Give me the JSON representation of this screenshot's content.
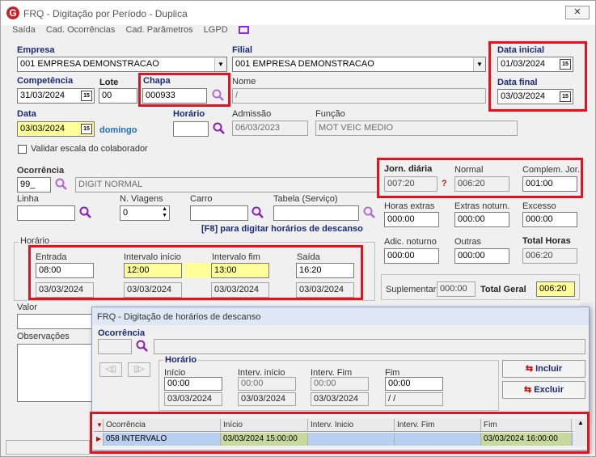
{
  "window": {
    "title": "FRQ - Digitação por Período - Duplica",
    "close": "✕"
  },
  "menu": [
    "Saída",
    "Cad. Ocorrências",
    "Cad. Parâmetros",
    "LGPD"
  ],
  "empresa": {
    "label": "Empresa",
    "value": "001 EMPRESA DEMONSTRACAO"
  },
  "filial": {
    "label": "Filial",
    "value": "001 EMPRESA DEMONSTRACAO"
  },
  "data_inicial": {
    "label": "Data inicial",
    "value": "01/03/2024"
  },
  "data_final": {
    "label": "Data final",
    "value": "03/03/2024"
  },
  "competencia": {
    "label": "Competência",
    "value": "31/03/2024"
  },
  "lote": {
    "label": "Lote",
    "value": "00"
  },
  "chapa": {
    "label": "Chapa",
    "value": "000933"
  },
  "nome": {
    "label": "Nome",
    "value": "/"
  },
  "data": {
    "label": "Data",
    "value": "03/03/2024",
    "weekday": "domingo"
  },
  "horario": {
    "label": "Horário",
    "value": ""
  },
  "admissao": {
    "label": "Admissão",
    "value": "06/03/2023"
  },
  "funcao": {
    "label": "Função",
    "value": "MOT VEIC MEDIO"
  },
  "validar": {
    "label": "Validar escala do colaborador"
  },
  "ocorrencia": {
    "label": "Ocorrência",
    "code": "99_",
    "desc": "DIGIT NORMAL"
  },
  "linha": {
    "label": "Linha",
    "value": ""
  },
  "n_viagens": {
    "label": "N. Viagens",
    "value": "0"
  },
  "carro": {
    "label": "Carro",
    "value": ""
  },
  "tabela": {
    "label": "Tabela (Serviço)",
    "value": ""
  },
  "f8_hint": "[F8] para digitar horários de descanso",
  "jorn": {
    "label": "Jorn. diária",
    "value": "007:20",
    "flag": "?"
  },
  "normal": {
    "label": "Normal",
    "value": "006:20"
  },
  "complem": {
    "label": "Complem. Jor.",
    "value": "001:00"
  },
  "horas_extras": {
    "label": "Horas extras",
    "value": "000:00"
  },
  "extras_noturn": {
    "label": "Extras noturn.",
    "value": "000:00"
  },
  "excesso": {
    "label": "Excesso",
    "value": "000:00"
  },
  "adic_noturno": {
    "label": "Adic. noturno",
    "value": "000:00"
  },
  "outras": {
    "label": "Outras",
    "value": "000:00"
  },
  "total_horas": {
    "label": "Total Horas",
    "value": "006:20"
  },
  "suplementar": {
    "label": "Suplementar",
    "value": "000:00"
  },
  "total_geral": {
    "label": "Total Geral",
    "value": "006:20"
  },
  "horario_group": {
    "label": "Horário",
    "entrada": {
      "label": "Entrada",
      "time": "08:00",
      "date": "03/03/2024"
    },
    "int_ini": {
      "label": "Intervalo início",
      "time": "12:00",
      "date": "03/03/2024"
    },
    "int_fim": {
      "label": "Intervalo fim",
      "time": "13:00",
      "date": "03/03/2024"
    },
    "saida": {
      "label": "Saída",
      "time": "16:20",
      "date": "03/03/2024"
    }
  },
  "valor": {
    "label": "Valor"
  },
  "observacoes": {
    "label": "Observações"
  },
  "dialog": {
    "title": "FRQ - Digitação de horários de descanso",
    "ocorrencia": {
      "label": "Ocorrência"
    },
    "horario": {
      "label": "Horário",
      "inicio": {
        "label": "Início",
        "time": "00:00",
        "date": "03/03/2024"
      },
      "int_ini": {
        "label": "Interv. início",
        "time": "00:00",
        "date": "03/03/2024"
      },
      "int_fim": {
        "label": "Interv. Fim",
        "time": "00:00",
        "date": "03/03/2024"
      },
      "fim": {
        "label": "Fim",
        "time": "00:00",
        "date": "/ /"
      }
    },
    "incluir": "Incluir",
    "excluir": "Excluir",
    "columns": [
      "Ocorrência",
      "Início",
      "Interv. Inicio",
      "Interv. Fim",
      "Fim"
    ],
    "rows": [
      {
        "ocorrencia": "058 INTERVALO",
        "inicio": "03/03/2024 15:00:00",
        "int_ini": "",
        "int_fim": "",
        "fim": "03/03/2024 16:00:00"
      }
    ]
  },
  "colors": {
    "highlight": "#e0141e",
    "label_blue": "#1b2a7a",
    "yellow": "#ffff9a",
    "grid_green": "#c8d9a0",
    "row_blue": "#b9cff0"
  }
}
